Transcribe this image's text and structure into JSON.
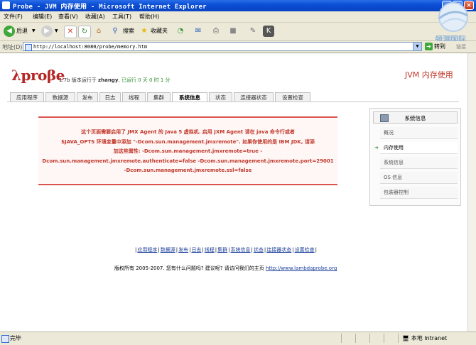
{
  "window": {
    "title": "Probe - JVM 内存使用 - Microsoft Internet Explorer"
  },
  "menu": [
    "文件(F)",
    "编辑(E)",
    "查看(V)",
    "收藏(A)",
    "工具(T)",
    "帮助(H)"
  ],
  "toolbar": {
    "back": "后退",
    "search": "搜索",
    "favorites": "收藏夹"
  },
  "address": {
    "label": "地址(D)",
    "url": "http://localhost:8080/probe/memory.htm",
    "go": "转到",
    "links": "链接"
  },
  "watermark": {
    "text": "领测国际"
  },
  "header": {
    "logo": "λproβe",
    "version": "1.7b 版本运行于",
    "user": "zhangy",
    "uptime": "已运行 0 天 0 时 1 分",
    "page_title": "JVM 内存使用"
  },
  "tabs": [
    "应用程序",
    "数据源",
    "发布",
    "日志",
    "线程",
    "集群",
    "系统信息",
    "状态",
    "连接器状态",
    "设置检查"
  ],
  "warning": {
    "lines": [
      "这个页面需要启用了 JMX Agent 的 Java 5 虚拟机. 启用 JXM Agent 请在 java 命令行或者",
      "$JAVA_OPTS 环境变量中添加 \"-Dcom.sun.management.jmxremote\". 如果你使用的是 IBM JDK, 请添",
      "加这些属性: -Dcom.sun.management.jmxremote=true -",
      "Dcom.sun.management.jmxremote.authenticate=false -Dcom.sun.management.jmxremote.port=29001",
      "-Dcom.sun.management.jmxremote.ssl=false"
    ]
  },
  "sidepanel": {
    "header": "系统信息",
    "items": [
      "概况",
      "内存使用",
      "系统信息",
      "OS 信息",
      "包装器控制"
    ]
  },
  "footer": {
    "links": [
      "应用程序",
      "数据源",
      "发布",
      "日志",
      "线程",
      "集群",
      "系统信息",
      "状态",
      "连接器状态",
      "设置检查"
    ],
    "copyright": "版权所有 2005-2007. 您有什么问题吗? 建议呢? 请访问我们的主页",
    "homepage": "http://www.lambdaprobe.org"
  },
  "status": {
    "text": "完毕",
    "zone": "本地 Intranet"
  },
  "colors": {
    "titlebar": "#0b4fd6",
    "accent_red": "#c0392b",
    "link_blue": "#1a3e9a"
  }
}
